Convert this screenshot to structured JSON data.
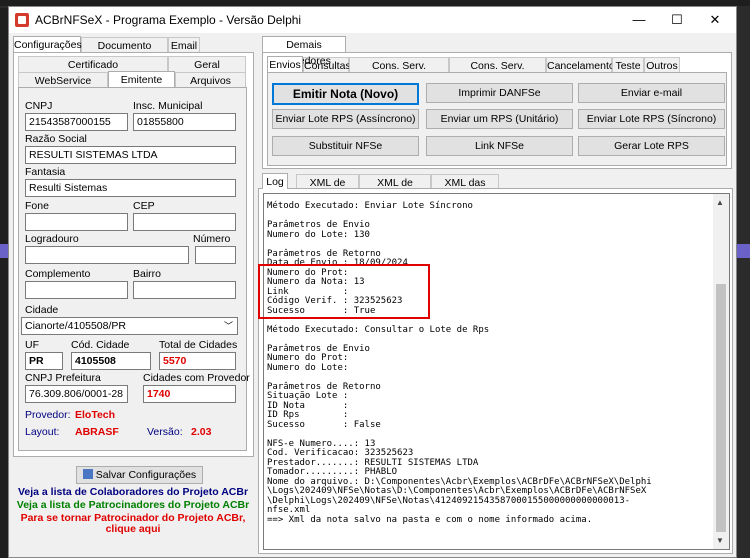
{
  "window": {
    "title": "ACBrNFSeX - Programa Exemplo - Versão Delphi",
    "minimize": "—",
    "maximize": "☐",
    "close": "✕"
  },
  "left": {
    "top_tabs": [
      "Configurações",
      "Documento Auxiliar",
      "Email"
    ],
    "sub_tabs_row1": [
      "Certificado",
      "Geral"
    ],
    "sub_tabs_row2": [
      "WebService",
      "Emitente",
      "Arquivos"
    ],
    "form": {
      "cnpj_label": "CNPJ",
      "cnpj": "21543587000155",
      "insc_label": "Insc. Municipal",
      "insc": "01855800",
      "razao_label": "Razão Social",
      "razao": "RESULTI SISTEMAS LTDA",
      "fantasia_label": "Fantasia",
      "fantasia": "Resulti Sistemas",
      "fone_label": "Fone",
      "fone": "",
      "cep_label": "CEP",
      "cep": "",
      "logradouro_label": "Logradouro",
      "logradouro": "",
      "numero_label": "Número",
      "numero": "",
      "complemento_label": "Complemento",
      "complemento": "",
      "bairro_label": "Bairro",
      "bairro": "",
      "cidade_label": "Cidade",
      "cidade": "Cianorte/4105508/PR",
      "uf_label": "UF",
      "uf": "PR",
      "cod_cidade_label": "Cód. Cidade",
      "cod_cidade": "4105508",
      "total_label": "Total de Cidades",
      "total": "5570",
      "cnpj_pref_label": "CNPJ Prefeitura",
      "cnpj_pref": "76.309.806/0001-28",
      "cid_prov_label": "Cidades com Provedor",
      "cid_prov": "1740",
      "provedor_label": "Provedor:",
      "provedor": "EloTech",
      "layout_label": "Layout:",
      "layout": "ABRASF",
      "versao_label": "Versão:",
      "versao": "2.03"
    },
    "save_button": "Salvar Configurações",
    "link1": "Veja a lista de Colaboradores do Projeto ACBr",
    "link2": "Veja a lista de Patrocinadores do Projeto ACBr",
    "link3a": "Para se tornar Patrocinador do Projeto ACBr,",
    "link3b": "clique aqui"
  },
  "right": {
    "outer_tab": "Demais Provedores",
    "tabs": [
      "Envios",
      "Consultas",
      "Cons. Serv. Prestados",
      "Cons. Serv. Tomados",
      "Cancelamento",
      "Teste",
      "Outros"
    ],
    "buttons": {
      "emitir": "Emitir Nota (Novo)",
      "imprimir": "Imprimir DANFSe",
      "enviar_email": "Enviar e-mail",
      "lote_assinc": "Enviar Lote RPS (Assíncrono)",
      "rps_unitario": "Enviar um RPS (Unitário)",
      "lote_sinc": "Enviar Lote RPS (Síncrono)",
      "substituir": "Substituir NFSe",
      "link_nfse": "Link NFSe",
      "gerar_lote": "Gerar Lote RPS"
    },
    "log_tabs": [
      "Log",
      "XML de Envio",
      "XML de Retorno",
      "XML das Notas"
    ],
    "log_text": "Método Executado: Enviar Lote Síncrono\n\nParâmetros de Envio\nNumero do Lote: 130\n\nParâmetros de Retorno\nData de Envio : 18/09/2024\nNumero do Prot:\nNumero da Nota: 13\nLink          :\nCódigo Verif. : 323525623\nSucesso       : True\n\nMétodo Executado: Consultar o Lote de Rps\n\nParâmetros de Envio\nNumero do Prot:\nNumero do Lote:\n\nParâmetros de Retorno\nSituação Lote :\nID Nota       :\nID Rps        :\nSucesso       : False\n\nNFS-e Numero....: 13\nCod. Verificacao: 323525623\nPrestador.......: RESULTI SISTEMAS LTDA\nTomador.........: PHABLO\nNome do arquivo.: D:\\Componentes\\Acbr\\Exemplos\\ACBrDFe\\ACBrNFSeX\\Delphi\n\\Logs\\202409\\NFSe\\Notas\\D:\\Componentes\\Acbr\\Exemplos\\ACBrDFe\\ACBrNFSeX\n\\Delphi\\Logs\\202409\\NFSe\\Notas\\41240921543587000155000000000000013-\nnfse.xml\n==> Xml da nota salvo na pasta e com o nome informado acima."
  },
  "colors": {
    "accent": "#0078d7",
    "red": "#e00000",
    "link_blue": "#000080",
    "link_green": "#008000"
  }
}
